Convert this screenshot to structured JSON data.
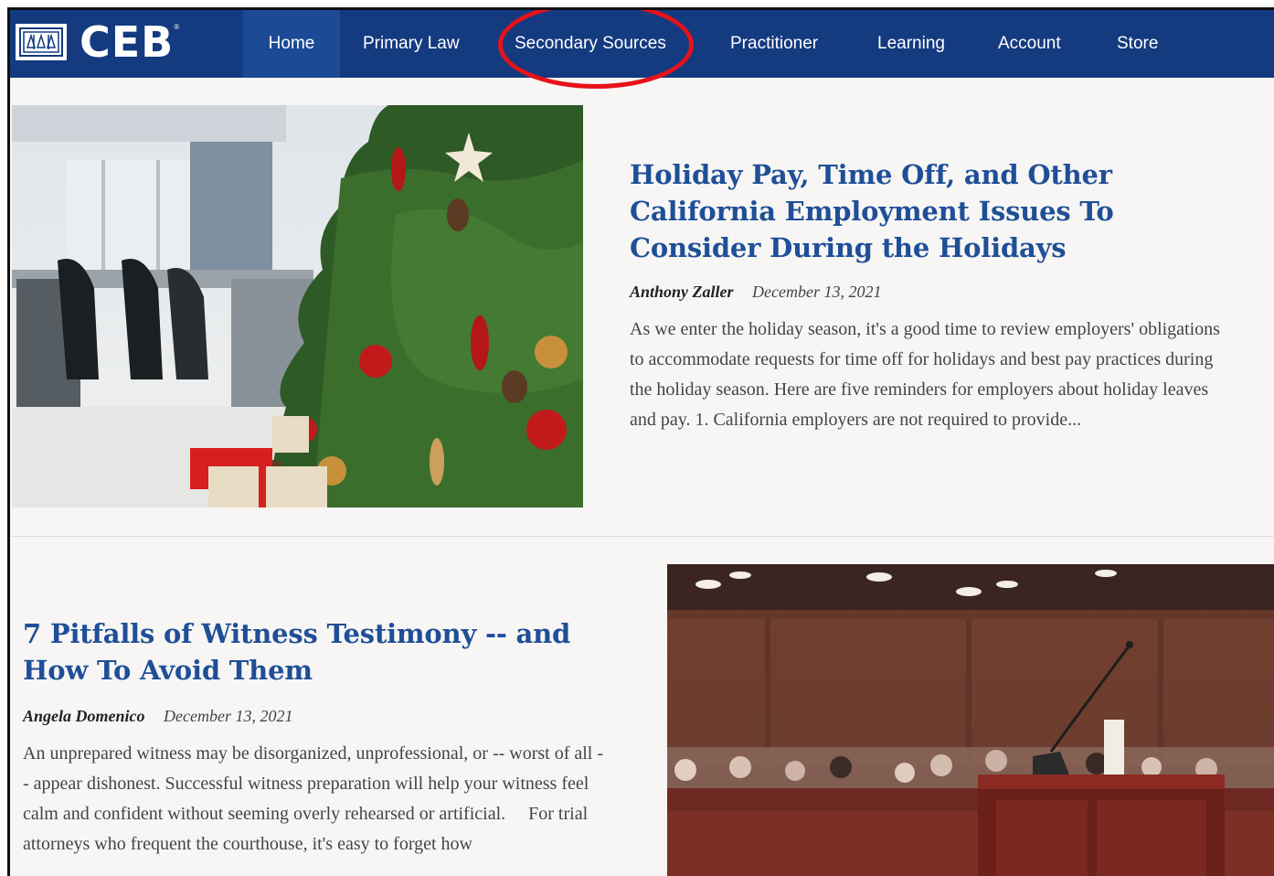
{
  "brand": {
    "name": "CEB"
  },
  "nav": {
    "items": [
      {
        "label": "Home",
        "active": true
      },
      {
        "label": "Primary Law"
      },
      {
        "label": "Secondary Sources",
        "highlighted": true
      },
      {
        "label": "Practitioner"
      },
      {
        "label": "Learning"
      },
      {
        "label": "Account"
      },
      {
        "label": "Store"
      }
    ]
  },
  "articles": [
    {
      "title": "Holiday Pay, Time Off, and Other California Employment Issues To Consider During the Holidays",
      "author": "Anthony Zaller",
      "date": "December 13, 2021",
      "excerpt": "As we enter the holiday season, it's a good time to review employers' obligations to accommodate requests for time off for holidays and best pay practices during the holiday season. Here are five reminders for employers about holiday leaves and pay. 1. California employers are not required to provide...",
      "image": "christmas-tree-office-photo"
    },
    {
      "title": "7 Pitfalls of Witness Testimony -- and How To Avoid Them",
      "author": "Angela Domenico",
      "date": "December 13, 2021",
      "excerpt": "An unprepared witness may be disorganized, unprofessional, or -- worst of all -- appear dishonest. Successful witness preparation will help your witness feel calm and confident without seeming overly rehearsed or artificial.     For trial attorneys who frequent the courthouse, it's easy to forget how",
      "image": "courtroom-podium-photo"
    }
  ],
  "colors": {
    "nav_bg": "#143a80",
    "nav_active": "#1d4a95",
    "title_blue": "#1f4f97",
    "highlight_ring": "#e8121a",
    "page_bg": "#f7f6f5"
  }
}
